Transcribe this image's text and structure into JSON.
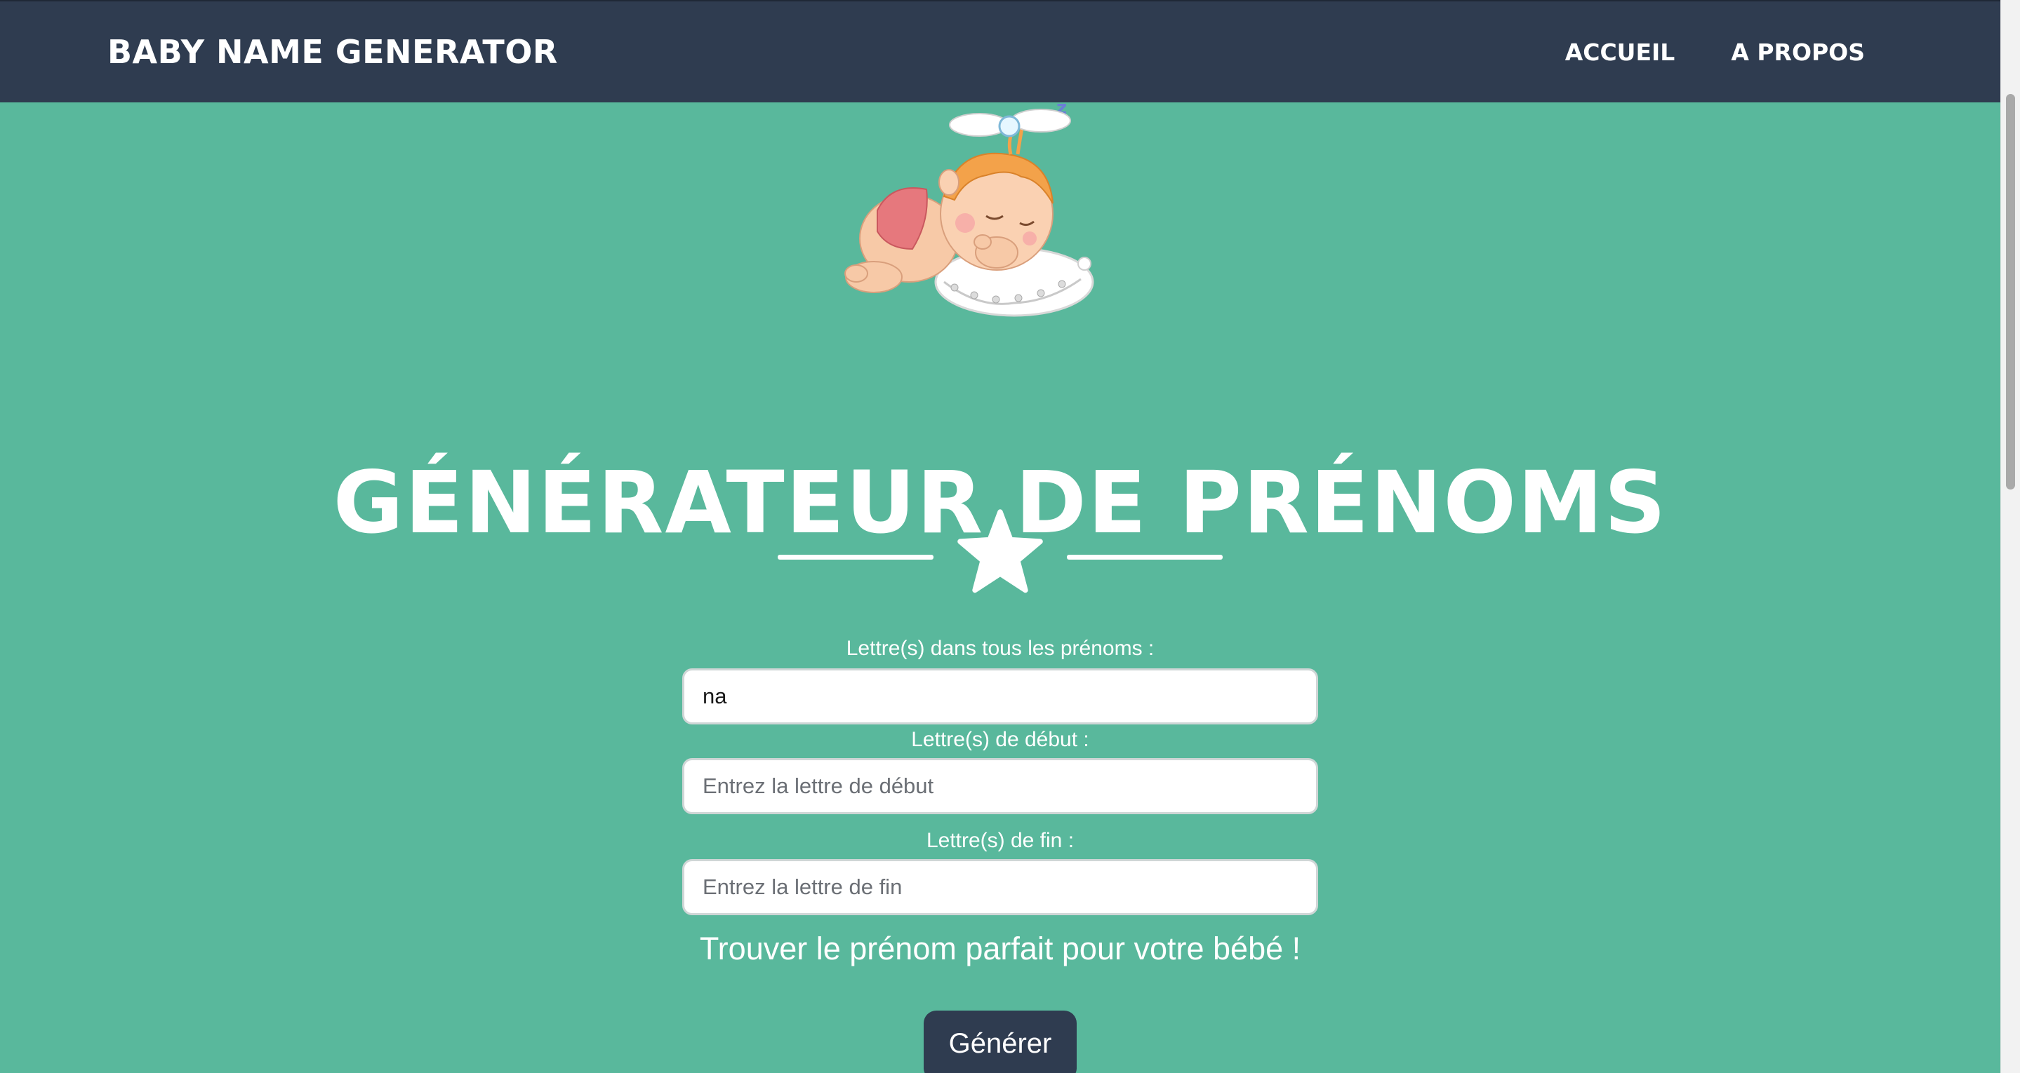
{
  "navbar": {
    "brand": "BABY NAME GENERATOR",
    "links": [
      {
        "label": "ACCUEIL"
      },
      {
        "label": "A PROPOS"
      }
    ]
  },
  "hero": {
    "illustration_icon": "sleeping-baby-angel-illustration",
    "title": "GÉNÉRATEUR DE PRÉNOMS",
    "divider_icon": "star-icon"
  },
  "form": {
    "contains": {
      "label": "Lettre(s) dans tous les prénoms :",
      "value": "na",
      "placeholder": ""
    },
    "start": {
      "label": "Lettre(s) de début :",
      "value": "",
      "placeholder": "Entrez la lettre de début"
    },
    "end": {
      "label": "Lettre(s) de fin :",
      "value": "",
      "placeholder": "Entrez la lettre de fin"
    },
    "tagline": "Trouver le prénom parfait pour votre bébé !",
    "submit_label": "Générer"
  },
  "colors": {
    "background": "#59b89c",
    "navbar": "#2f3c50",
    "button": "#2f3c50",
    "text_light": "#ffffff"
  }
}
